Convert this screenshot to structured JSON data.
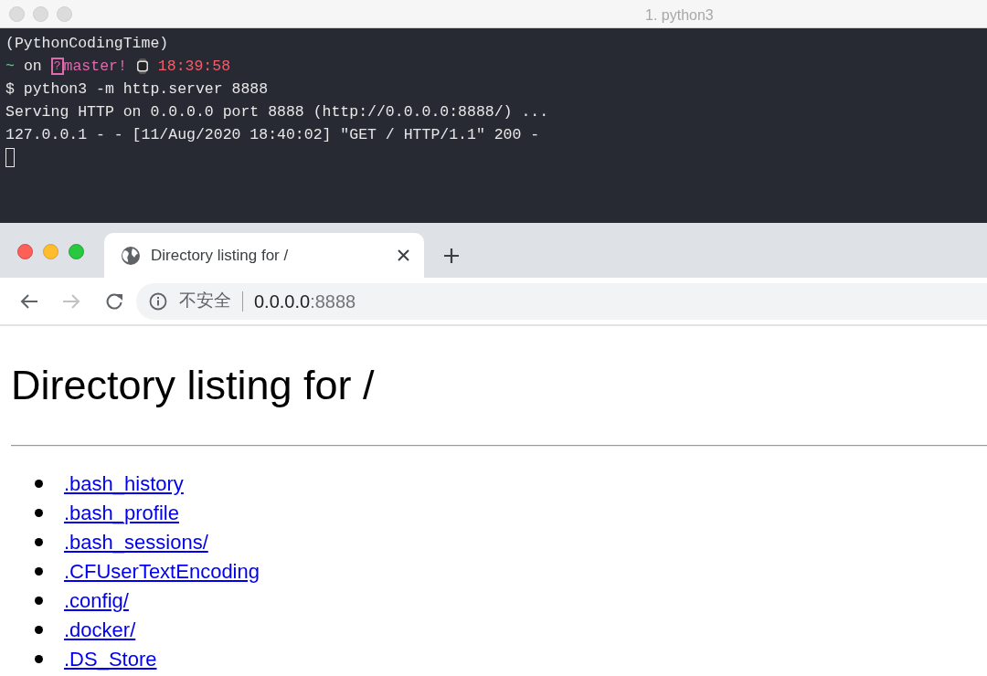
{
  "terminal": {
    "title": "1. python3",
    "lines": [
      {
        "kind": "text",
        "text": "(PythonCodingTime)"
      },
      {
        "kind": "prompt",
        "dir": "~",
        "word": "on",
        "status": "?",
        "branch": "master!",
        "time": "18:39:58"
      },
      {
        "kind": "text",
        "text": "$ python3 -m http.server 8888"
      },
      {
        "kind": "text",
        "text": "Serving HTTP on 0.0.0.0 port 8888 (http://0.0.0.0:8888/) ..."
      },
      {
        "kind": "text",
        "text": "127.0.0.1 - - [11/Aug/2020 18:40:02] \"GET / HTTP/1.1\" 200 -"
      },
      {
        "kind": "cursor"
      }
    ]
  },
  "browser": {
    "tabs": [
      {
        "title": "Directory listing for /",
        "selected": true
      }
    ],
    "back_disabled": false,
    "forward_disabled": true,
    "address": {
      "security": "不安全",
      "host": "0.0.0.0",
      "port": ":8888"
    },
    "page": {
      "heading": "Directory listing for /",
      "links": [
        ".bash_history",
        ".bash_profile",
        ".bash_sessions/",
        ".CFUserTextEncoding",
        ".config/",
        ".docker/",
        ".DS_Store"
      ]
    }
  }
}
